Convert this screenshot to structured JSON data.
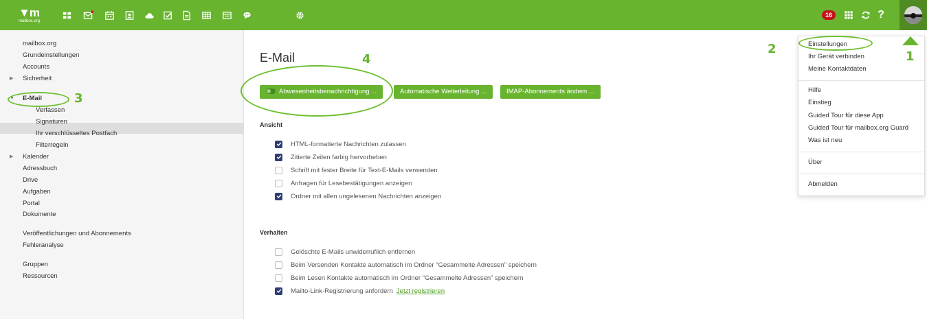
{
  "topbar": {
    "logo_text": "mailbox.org",
    "app_icons": [
      "apps-icon",
      "mail-icon",
      "calendar-icon",
      "contacts-icon",
      "cloud-icon",
      "tasks-icon",
      "documents-icon",
      "spreadsheet-icon",
      "presentation-icon",
      "chat-icon",
      "settings-icon"
    ],
    "notification_count": "16",
    "help_label": "?",
    "brand_color": "#68b42f"
  },
  "sidebar": {
    "items": [
      {
        "label": "mailbox.org"
      },
      {
        "label": "Grundeinstellungen"
      },
      {
        "label": "Accounts"
      },
      {
        "label": "Sicherheit"
      },
      {
        "label": "E-Mail"
      },
      {
        "label": "Verfassen"
      },
      {
        "label": "Signaturen"
      },
      {
        "label": "Ihr verschlüsseltes Postfach"
      },
      {
        "label": "Filterregeln"
      },
      {
        "label": "Kalender"
      },
      {
        "label": "Adressbuch"
      },
      {
        "label": "Drive"
      },
      {
        "label": "Aufgaben"
      },
      {
        "label": "Portal"
      },
      {
        "label": "Dokumente"
      },
      {
        "label": "Veröffentlichungen und Abonnements"
      },
      {
        "label": "Fehleranalyse"
      },
      {
        "label": "Gruppen"
      },
      {
        "label": "Ressourcen"
      }
    ]
  },
  "main": {
    "title": "E-Mail",
    "buttons": [
      {
        "label": "Abwesenheitsbenachrichtigung ..."
      },
      {
        "label": "Automatische Weiterleitung ..."
      },
      {
        "label": "IMAP-Abonnements ändern ..."
      }
    ],
    "ansicht": {
      "heading": "Ansicht",
      "options": [
        {
          "label": "HTML-formatierte Nachrichten zulassen",
          "checked": true
        },
        {
          "label": "Zitierte Zeilen farbig hervorheben",
          "checked": true
        },
        {
          "label": "Schrift mit fester Breite für Text-E-Mails verwenden",
          "checked": false
        },
        {
          "label": "Anfragen für Lesebestätigungen anzeigen",
          "checked": false
        },
        {
          "label": "Ordner mit allen ungelesenen Nachrichten anzeigen",
          "checked": true
        }
      ]
    },
    "verhalten": {
      "heading": "Verhalten",
      "options": [
        {
          "label": "Gelöschte E-Mails unwiderruflich entfernen",
          "checked": false
        },
        {
          "label": "Beim Versenden Kontakte automatisch im Ordner \"Gesammelte Adressen\" speichern",
          "checked": false
        },
        {
          "label": "Beim Lesen Kontakte automatisch im Ordner \"Gesammelte Adressen\" speichern",
          "checked": false
        },
        {
          "label": "Mailto-Link-Registrierung anfordern",
          "checked": true
        }
      ],
      "link": "Jetzt registrieren"
    }
  },
  "dropdown": {
    "items": [
      {
        "label": "Einstellungen"
      },
      {
        "label": "Ihr Gerät verbinden"
      },
      {
        "label": "Meine Kontaktdaten"
      },
      {
        "label": "Hilfe"
      },
      {
        "label": "Einstieg"
      },
      {
        "label": "Guided Tour für diese App"
      },
      {
        "label": "Guided Tour für mailbox.org Guard"
      },
      {
        "label": "Was ist neu"
      },
      {
        "label": "Über"
      },
      {
        "label": "Abmelden"
      }
    ]
  },
  "annotations": {
    "n1": "1",
    "n2": "2",
    "n3": "3",
    "n4": "4"
  }
}
